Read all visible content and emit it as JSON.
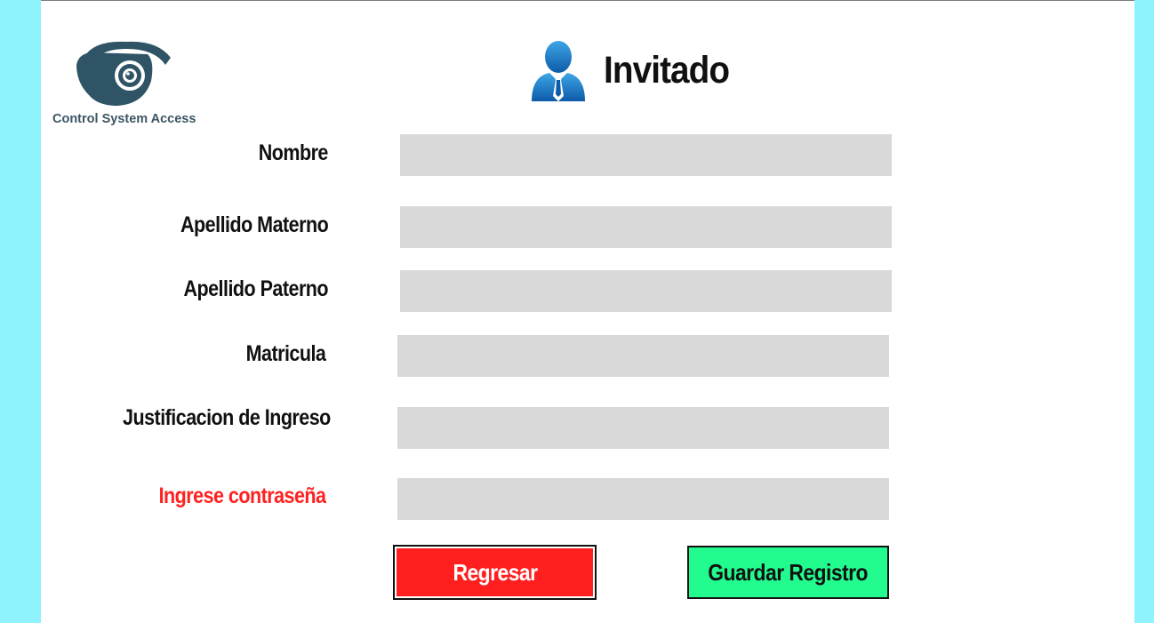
{
  "brand": {
    "logo_text": "Control System Access"
  },
  "header": {
    "title": "Invitado"
  },
  "form": {
    "fields": [
      {
        "label": "Nombre",
        "value": ""
      },
      {
        "label": "Apellido Materno",
        "value": ""
      },
      {
        "label": "Apellido Paterno",
        "value": ""
      },
      {
        "label": "Matricula",
        "value": ""
      },
      {
        "label": "Justificacion de Ingreso",
        "value": ""
      },
      {
        "label": "Ingrese contraseña",
        "value": "",
        "label_color": "#ff2020"
      }
    ]
  },
  "actions": {
    "back_label": "Regresar",
    "save_label": "Guardar Registro"
  },
  "colors": {
    "background": "#8ef3fd",
    "panel": "#ffffff",
    "field": "#d9d9d9",
    "back_button": "#ff1f1f",
    "save_button": "#22fc8e",
    "password_label": "#ff2020"
  },
  "icons": {
    "logo": "security-camera-icon",
    "user": "user-icon"
  }
}
